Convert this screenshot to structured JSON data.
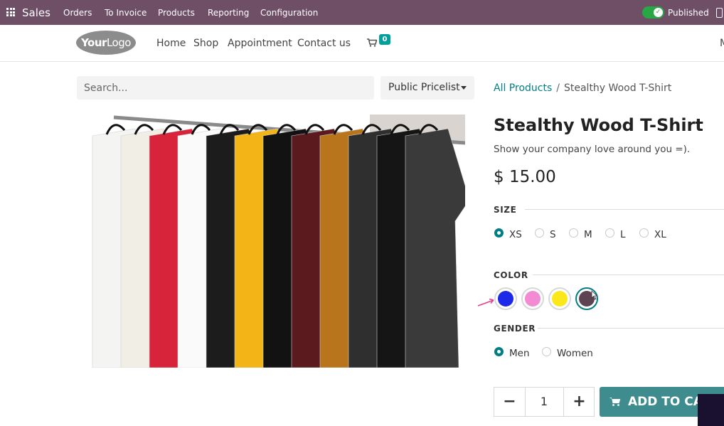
{
  "topbar": {
    "app_name": "Sales",
    "menu": [
      "Orders",
      "To Invoice",
      "Products",
      "Reporting",
      "Configuration"
    ],
    "published_label": "Published",
    "published": true
  },
  "header": {
    "logo_text_bold": "Your",
    "logo_text_light": "Logo",
    "nav": [
      "Home",
      "Shop",
      "Appointment",
      "Contact us"
    ],
    "cart_count": "0",
    "nav_right_partial": "M"
  },
  "search": {
    "placeholder": "Search...",
    "pricelist_label": "Public Pricelist"
  },
  "breadcrumb": {
    "parent": "All Products",
    "separator": "/",
    "current": "Stealthy Wood T-Shirt"
  },
  "product": {
    "name": "Stealthy Wood T-Shirt",
    "description": "Show your company love around you =).",
    "price": "$ 15.00",
    "image_alt": "T-shirts on hangers",
    "shirt_colors": [
      "#f4f4f2",
      "#f1eee6",
      "#d8243a",
      "#fafafa",
      "#1c1c1c",
      "#f2b417",
      "#121212",
      "#5a1a1e",
      "#b9751c",
      "#2f2f2f",
      "#151515",
      "#3a3a3a"
    ],
    "attributes": {
      "size": {
        "label": "SIZE",
        "options": [
          "XS",
          "S",
          "M",
          "L",
          "XL"
        ],
        "selected": "XS"
      },
      "color": {
        "label": "COLOR",
        "swatches": [
          "#1c29e8",
          "#f28ad4",
          "#fbe81b",
          "#5e4452"
        ],
        "selected_index": 3
      },
      "gender": {
        "label": "GENDER",
        "options": [
          "Men",
          "Women"
        ],
        "selected": "Men"
      }
    },
    "quantity": "1",
    "minus_label": "−",
    "plus_label": "+",
    "add_to_cart_label": "ADD TO CART"
  },
  "colors": {
    "admin_bar": "#6e4f66",
    "accent": "#017e84",
    "add_to_cart_bg": "#3e8c8e",
    "toggle_on": "#28a745",
    "annotation_arrow": "#e83e8c"
  }
}
